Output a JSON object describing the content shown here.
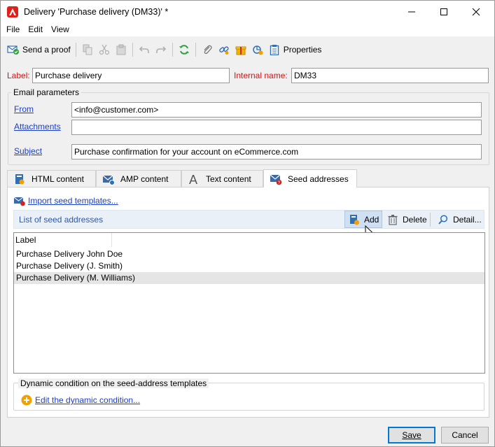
{
  "window": {
    "title": "Delivery 'Purchase delivery (DM33)' *",
    "app_icon": "adobe-icon"
  },
  "menu": [
    "File",
    "Edit",
    "View"
  ],
  "toolbar": {
    "send_proof": "Send a proof",
    "properties": "Properties"
  },
  "form": {
    "label_caption": "Label:",
    "label_value": "Purchase delivery",
    "internal_name_caption": "Internal name:",
    "internal_name_value": "DM33"
  },
  "email": {
    "group_title": "Email parameters",
    "from_label": "From",
    "from_value": "<info@customer.com>",
    "attachments_label": "Attachments",
    "attachments_value": "",
    "subject_label": "Subject",
    "subject_value": "Purchase confirmation for your account on eCommerce.com"
  },
  "tabs": [
    {
      "label": "HTML content",
      "icon": "html-content-icon"
    },
    {
      "label": "AMP content",
      "icon": "amp-content-icon"
    },
    {
      "label": "Text content",
      "icon": "text-content-icon"
    },
    {
      "label": "Seed addresses",
      "icon": "seed-addresses-icon",
      "active": true
    }
  ],
  "seed": {
    "import_link": "Import seed templates...",
    "list_title": "List of seed addresses",
    "add": "Add",
    "delete": "Delete",
    "detail": "Detail...",
    "column_label": "Label",
    "rows": [
      "Purchase Delivery John Doe",
      "Purchase Delivery (J. Smith)",
      "Purchase Delivery (M. Williams)"
    ],
    "dynamic_group_title": "Dynamic condition on the seed-address templates",
    "edit_dynamic": "Edit the dynamic condition..."
  },
  "buttons": {
    "save": "Save",
    "cancel": "Cancel"
  },
  "colors": {
    "required_label": "#d21414",
    "link": "#1a3ec8",
    "accent": "#0078d7",
    "adobe_red": "#e0201b"
  }
}
